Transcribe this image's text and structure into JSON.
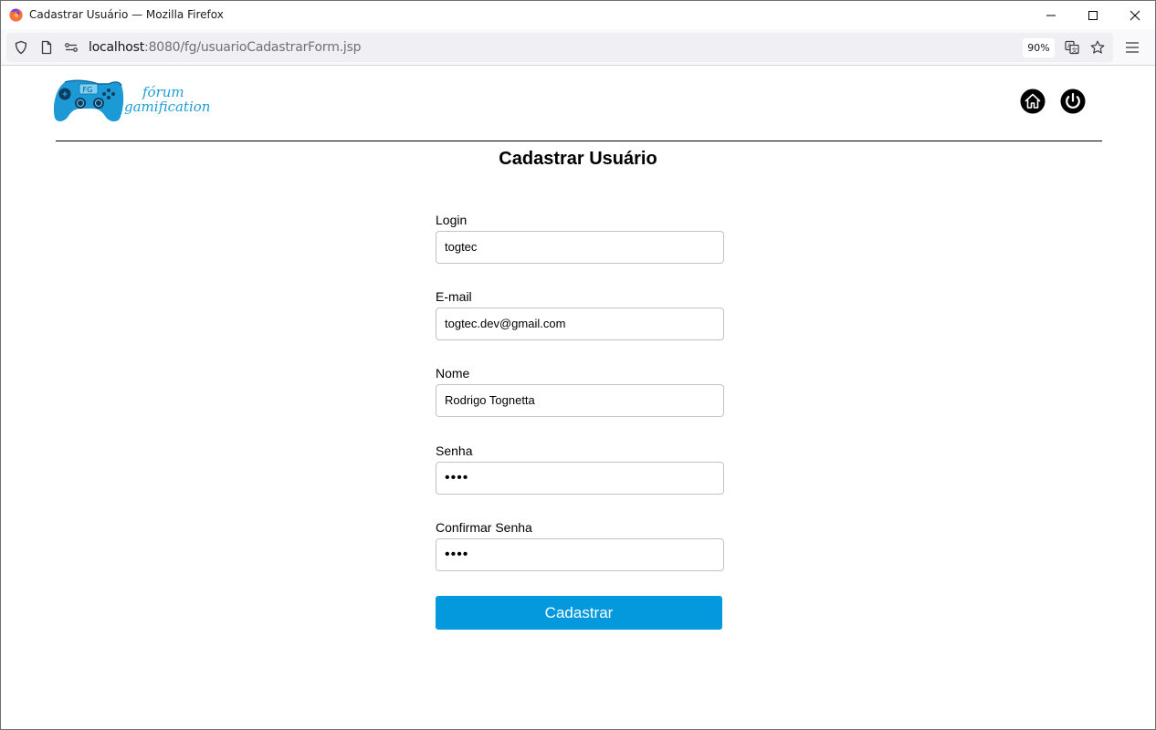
{
  "window": {
    "title": "Cadastrar Usuário — Mozilla Firefox"
  },
  "navbar": {
    "url_host": "localhost",
    "url_path": ":8080/fg/usuarioCadastrarForm.jsp",
    "zoom": "90%"
  },
  "header": {
    "logo_badge": "FG",
    "logo_line1": "fórum",
    "logo_line2": "gamification"
  },
  "page": {
    "title": "Cadastrar Usuário"
  },
  "form": {
    "fields": [
      {
        "label": "Login",
        "value": "togtec"
      },
      {
        "label": "E-mail",
        "value": "togtec.dev@gmail.com"
      },
      {
        "label": "Nome",
        "value": "Rodrigo Tognetta"
      },
      {
        "label": "Senha",
        "value": "••••"
      },
      {
        "label": "Confirmar Senha",
        "value": "••••"
      }
    ],
    "submit_label": "Cadastrar"
  },
  "colors": {
    "accent": "#0399dc",
    "logo_blue": "#1e9ed8"
  },
  "icons": [
    "firefox-icon",
    "minimize-icon",
    "maximize-icon",
    "close-icon",
    "shield-icon",
    "page-icon",
    "permissions-icon",
    "translate-icon",
    "bookmark-star-icon",
    "menu-icon",
    "home-icon",
    "power-icon"
  ]
}
